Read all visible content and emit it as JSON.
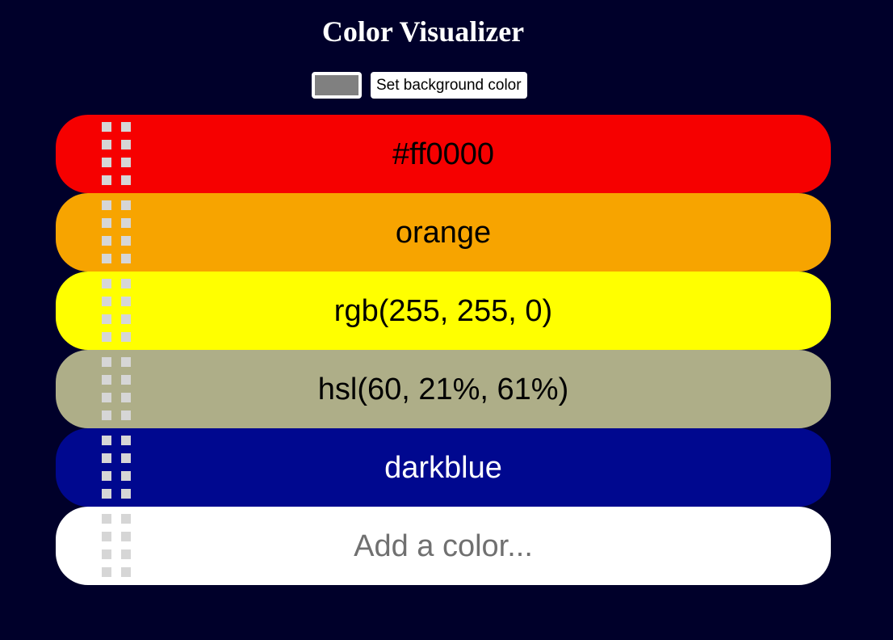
{
  "header": {
    "title": "Color Visualizer"
  },
  "controls": {
    "swatch_color": "#808080",
    "set_bg_label": "Set background color"
  },
  "colors": [
    {
      "label": "#ff0000",
      "bg": "#f60000",
      "text_color": "#000000"
    },
    {
      "label": "orange",
      "bg": "#f7a400",
      "text_color": "#000000"
    },
    {
      "label": "rgb(255, 255, 0)",
      "bg": "#ffff00",
      "text_color": "#000000"
    },
    {
      "label": "hsl(60, 21%, 61%)",
      "bg": "#aeae88",
      "text_color": "#000000"
    },
    {
      "label": "darkblue",
      "bg": "#00088f",
      "text_color": "#ffffff"
    }
  ],
  "add_row": {
    "placeholder": "Add a color...",
    "bg": "#ffffff"
  },
  "page": {
    "background": "#00002a"
  },
  "icons": {
    "handle": "drag-handle-icon"
  }
}
